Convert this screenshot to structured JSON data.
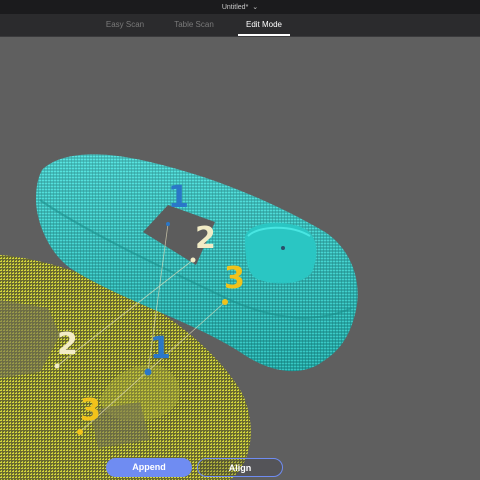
{
  "window": {
    "title": "Untitled*"
  },
  "tabs": [
    {
      "label": "Easy Scan",
      "active": false
    },
    {
      "label": "Table Scan",
      "active": false
    },
    {
      "label": "Edit Mode",
      "active": true
    }
  ],
  "markers": {
    "cyan_model": [
      "1",
      "2",
      "3"
    ],
    "yellow_model": [
      "2",
      "1",
      "3"
    ]
  },
  "colors": {
    "background": "#5f5f5f",
    "cyan_scan": "#2fd3cf",
    "yellow_scan": "#d8dc3a",
    "accent": "#6f8cf2",
    "marker_blue": "#2a77c8",
    "marker_cream": "#f2ecc6",
    "marker_gold": "#f2c21b"
  },
  "buttons": {
    "append": "Append",
    "align": "Align"
  }
}
